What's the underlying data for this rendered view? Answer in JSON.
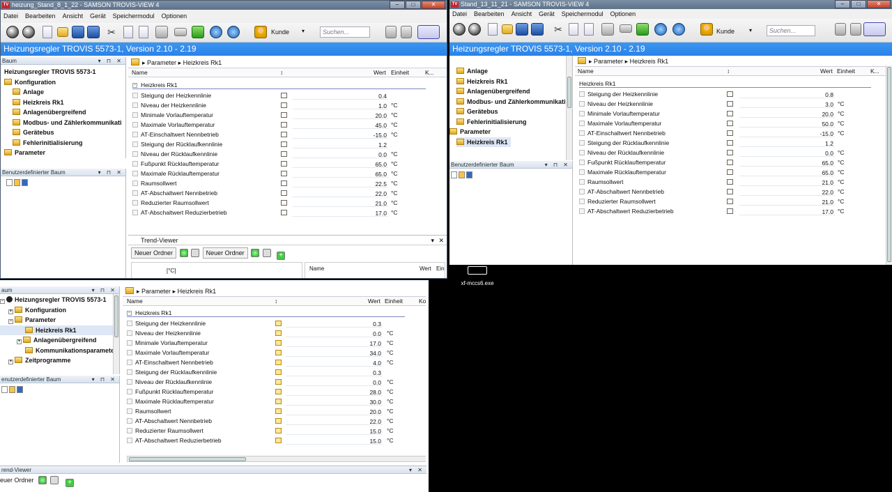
{
  "win1": {
    "title": "heizung_Stand_8_1_22 - SAMSON TROVIS-VIEW 4",
    "menus": [
      "Datei",
      "Bearbeiten",
      "Ansicht",
      "Gerät",
      "Speichermodul",
      "Optionen"
    ],
    "kunde": "Kunde",
    "search_placeholder": "Suchen...",
    "heading": "Heizungsregler TROVIS 5573-1, Version 2.10 - 2.19",
    "baum_title": "Baum",
    "tree": [
      "Heizungsregler TROVIS 5573-1",
      "Konfiguration",
      "Anlage",
      "Heizkreis Rk1",
      "Anlagenübergreifend",
      "Modbus- und Zählerkommunikati",
      "Gerätebus",
      "Fehlerinitialisierung",
      "Parameter"
    ],
    "custom_tree_title": "Benutzerdefinierter Baum",
    "breadcrumb": [
      "Parameter",
      "Heizkreis Rk1"
    ],
    "cols": {
      "name": "Name",
      "wert": "Wert",
      "einheit": "Einheit",
      "k": "K..."
    },
    "group": "Heizkreis Rk1",
    "rows": [
      {
        "name": "Steigung der Heizkennlinie",
        "value": "0.4",
        "unit": ""
      },
      {
        "name": "Niveau der Heizkennlinie",
        "value": "1.0",
        "unit": "°C"
      },
      {
        "name": "Minimale Vorlauftemperatur",
        "value": "20.0",
        "unit": "°C"
      },
      {
        "name": "Maximale Vorlauftemperatur",
        "value": "45.0",
        "unit": "°C"
      },
      {
        "name": "AT-Einschaltwert Nennbetrieb",
        "value": "-15.0",
        "unit": "°C"
      },
      {
        "name": "Steigung der Rücklaufkennlinie",
        "value": "1.2",
        "unit": ""
      },
      {
        "name": "Niveau der Rücklaufkennlinie",
        "value": "0.0",
        "unit": "°C"
      },
      {
        "name": "Fußpunkt Rücklauftemperatur",
        "value": "65.0",
        "unit": "°C"
      },
      {
        "name": "Maximale Rücklauftemperatur",
        "value": "65.0",
        "unit": "°C"
      },
      {
        "name": "Raumsollwert",
        "value": "22.5",
        "unit": "°C"
      },
      {
        "name": "AT-Abschaltwert Nennbetrieb",
        "value": "22.0",
        "unit": "°C"
      },
      {
        "name": "Reduzierter Raumsollwert",
        "value": "21.0",
        "unit": "°C"
      },
      {
        "name": "AT-Abschaltwert Reduzierbetrieb",
        "value": "17.0",
        "unit": "°C"
      }
    ],
    "trend": {
      "title": "Trend-Viewer",
      "tab1": "Neuer Ordner",
      "tab2": "Neuer Ordner",
      "unit": "[°C]",
      "col_name": "Name",
      "col_wert": "Wert",
      "col_ein": "Ein"
    }
  },
  "win2": {
    "title": "Stand_13_11_21 - SAMSON TROVIS-VIEW 4",
    "menus": [
      "Datei",
      "Bearbeiten",
      "Ansicht",
      "Gerät",
      "Speichermodul",
      "Optionen"
    ],
    "kunde": "Kunde",
    "search_placeholder": "Suchen...",
    "heading": "Heizungsregler TROVIS 5573-1, Version 2.10 - 2.19",
    "tree": [
      "Anlage",
      "Heizkreis Rk1",
      "Anlagenübergreifend",
      "Modbus- und Zählerkommunikatio",
      "Gerätebus",
      "Fehlerinitialisierung",
      "Parameter",
      "Heizkreis Rk1"
    ],
    "custom_tree_title": "Benutzerdefinierter Baum",
    "breadcrumb": [
      "Parameter",
      "Heizkreis Rk1"
    ],
    "cols": {
      "name": "Name",
      "wert": "Wert",
      "einheit": "Einheit",
      "k": "K..."
    },
    "group": "Heizkreis Rk1",
    "rows": [
      {
        "name": "Steigung der Heizkennlinie",
        "value": "0.8",
        "unit": ""
      },
      {
        "name": "Niveau der Heizkennlinie",
        "value": "3.0",
        "unit": "°C"
      },
      {
        "name": "Minimale Vorlauftemperatur",
        "value": "20.0",
        "unit": "°C"
      },
      {
        "name": "Maximale Vorlauftemperatur",
        "value": "50.0",
        "unit": "°C"
      },
      {
        "name": "AT-Einschaltwert Nennbetrieb",
        "value": "-15.0",
        "unit": "°C"
      },
      {
        "name": "Steigung der Rücklaufkennlinie",
        "value": "1.2",
        "unit": ""
      },
      {
        "name": "Niveau der Rücklaufkennlinie",
        "value": "0.0",
        "unit": "°C"
      },
      {
        "name": "Fußpunkt Rücklauftemperatur",
        "value": "65.0",
        "unit": "°C"
      },
      {
        "name": "Maximale Rücklauftemperatur",
        "value": "65.0",
        "unit": "°C"
      },
      {
        "name": "Raumsollwert",
        "value": "21.0",
        "unit": "°C"
      },
      {
        "name": "AT-Abschaltwert Nennbetrieb",
        "value": "22.0",
        "unit": "°C"
      },
      {
        "name": "Reduzierter Raumsollwert",
        "value": "21.0",
        "unit": "°C"
      },
      {
        "name": "AT-Abschaltwert Reduzierbetrieb",
        "value": "17.0",
        "unit": "°C"
      }
    ]
  },
  "win3": {
    "baum_title": "aum",
    "tree": [
      "Heizungsregler TROVIS 5573-1",
      "Konfiguration",
      "Parameter",
      "Heizkreis Rk1",
      "Anlagenübergreifend",
      "Kommunikationsparameter",
      "Zeitprogramme"
    ],
    "custom_tree_title": "enutzerdefinierter Baum",
    "breadcrumb": [
      "Parameter",
      "Heizkreis Rk1"
    ],
    "cols": {
      "name": "Name",
      "wert": "Wert",
      "einheit": "Einheit",
      "k": "Ko"
    },
    "group": "Heizkreis Rk1",
    "rows": [
      {
        "name": "Steigung der Heizkennlinie",
        "value": "0.3",
        "unit": ""
      },
      {
        "name": "Niveau der Heizkennlinie",
        "value": "0.0",
        "unit": "°C"
      },
      {
        "name": "Minimale Vorlauftemperatur",
        "value": "17.0",
        "unit": "°C"
      },
      {
        "name": "Maximale Vorlauftemperatur",
        "value": "34.0",
        "unit": "°C"
      },
      {
        "name": "AT-Einschaltwert Nennbetrieb",
        "value": "4.0",
        "unit": "°C"
      },
      {
        "name": "Steigung der Rücklaufkennlinie",
        "value": "0.3",
        "unit": ""
      },
      {
        "name": "Niveau der Rücklaufkennlinie",
        "value": "0.0",
        "unit": "°C"
      },
      {
        "name": "Fußpunkt Rücklauftemperatur",
        "value": "28.0",
        "unit": "°C"
      },
      {
        "name": "Maximale Rücklauftemperatur",
        "value": "30.0",
        "unit": "°C"
      },
      {
        "name": "Raumsollwert",
        "value": "20.0",
        "unit": "°C"
      },
      {
        "name": "AT-Abschaltwert Nennbetrieb",
        "value": "22.0",
        "unit": "°C"
      },
      {
        "name": "Reduzierter Raumsollwert",
        "value": "15.0",
        "unit": "°C"
      },
      {
        "name": "AT-Abschaltwert Reduzierbetrieb",
        "value": "15.0",
        "unit": "°C"
      }
    ],
    "trend": {
      "title": "rend-Viewer",
      "tab1": "euer Ordner"
    }
  },
  "desktop": {
    "file_label": "xf-mccs6.exe"
  }
}
